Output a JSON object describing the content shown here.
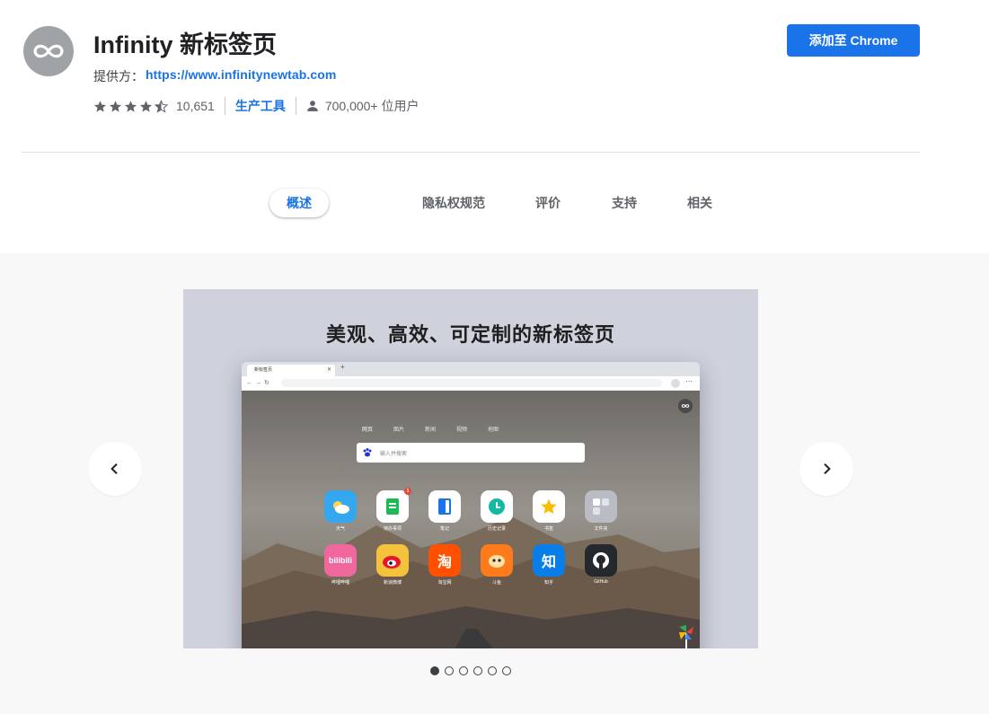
{
  "app": {
    "title": "Infinity 新标签页",
    "provider_label": "提供方：",
    "provider_url": "https://www.infinitynewtab.com",
    "rating_count": "10,651",
    "rating": 4.5,
    "category": "生产工具",
    "users": "700,000+ 位用户",
    "add_button": "添加至 Chrome"
  },
  "tabs": [
    "概述",
    "隐私权规范",
    "评价",
    "支持",
    "相关"
  ],
  "active_tab": 0,
  "gallery": {
    "slide_heading": "美观、高效、可定制的新标签页",
    "browser_tab_title": "新标签页",
    "search_tabs": [
      "网页",
      "图片",
      "新闻",
      "视频",
      "地图"
    ],
    "search_placeholder": "输入并搜索",
    "apps": [
      {
        "label": "天气",
        "icon": "weather-icon",
        "color": "#35a7ef"
      },
      {
        "label": "待办事项",
        "icon": "todo-icon",
        "color": "#ffffff",
        "badge": "1"
      },
      {
        "label": "笔记",
        "icon": "notes-icon",
        "color": "#ffffff"
      },
      {
        "label": "历史记录",
        "icon": "history-icon",
        "color": "#ffffff"
      },
      {
        "label": "书签",
        "icon": "bookmark-star-icon",
        "color": "#ffffff"
      },
      {
        "label": "文件夹",
        "icon": "folder-icon",
        "color": "#b9bcc2"
      },
      {
        "label": "哔哩哔哩",
        "icon": "bilibili-icon",
        "color": "#f0679e",
        "text": "bilibili"
      },
      {
        "label": "新浪微博",
        "icon": "weibo-icon",
        "color": "#f5c33b"
      },
      {
        "label": "淘宝网",
        "icon": "taobao-icon",
        "color": "#ff5000",
        "text": "淘"
      },
      {
        "label": "斗鱼",
        "icon": "douyu-icon",
        "color": "#ff7a1a"
      },
      {
        "label": "知乎",
        "icon": "zhihu-icon",
        "color": "#0a7ee8",
        "text": "知"
      },
      {
        "label": "GitHub",
        "icon": "github-icon",
        "color": "#24292e"
      }
    ],
    "slide_count": 6,
    "active_slide": 0
  },
  "colors": {
    "accent": "#1a73e8",
    "text_secondary": "#5f6368",
    "gallery_bg": "#f8f8f8"
  }
}
